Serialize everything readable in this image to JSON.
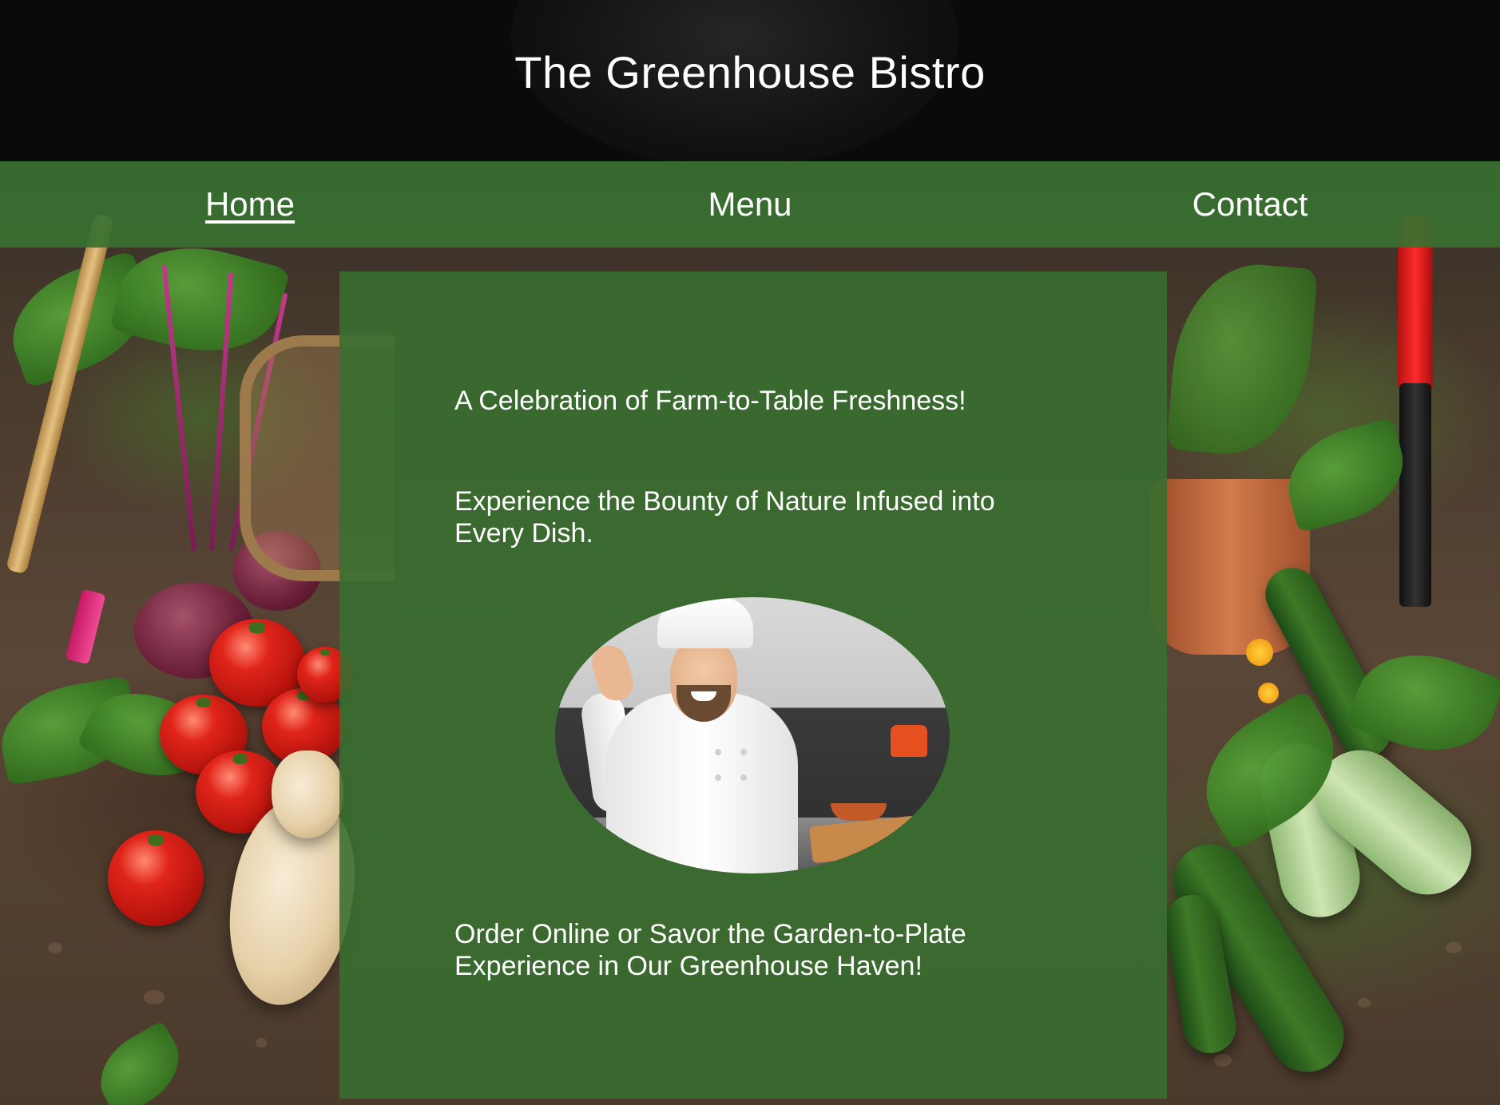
{
  "header": {
    "title": "The Greenhouse Bistro"
  },
  "nav": {
    "items": [
      {
        "label": "Home",
        "active": true
      },
      {
        "label": "Menu",
        "active": false
      },
      {
        "label": "Contact",
        "active": false
      }
    ]
  },
  "main": {
    "taglines": [
      "A Celebration of Farm-to-Table Freshness!",
      "Experience the Bounty of Nature Infused into Every Dish.",
      "Order Online or Savor the Garden-to-Plate Experience in Our Greenhouse Haven!"
    ],
    "image": {
      "subject": "smiling chef in white uniform and toque in a kitchen"
    }
  },
  "background": {
    "subject": "garden vegetables: tomatoes, beets, squash, cucumbers, zucchini, potted herbs, garden hoe"
  },
  "colors": {
    "header_bg": "#0a0a0a",
    "nav_bg": "#387030",
    "card_bg": "#387030",
    "text": "#ffffff"
  }
}
